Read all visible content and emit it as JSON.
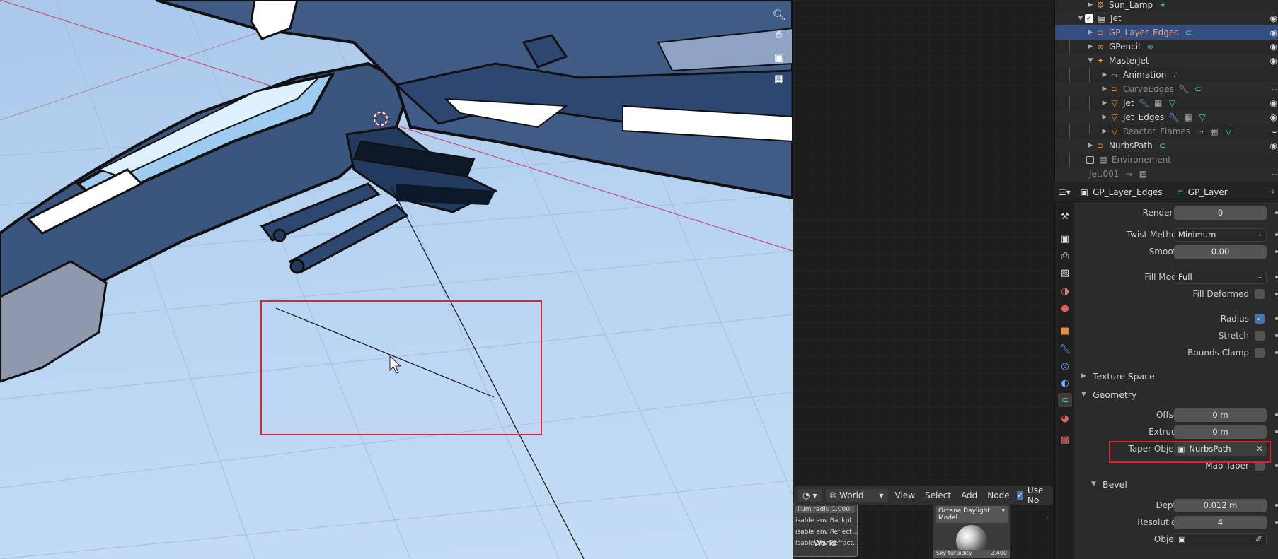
{
  "viewport": {
    "gizmo_icons": [
      "zoom-icon",
      "hand-icon",
      "camera-icon",
      "grid-icon"
    ]
  },
  "node_editor": {
    "header": {
      "world_label": "World",
      "menus": [
        "View",
        "Select",
        "Add",
        "Node"
      ],
      "use_nodes_label": "Use No"
    },
    "left_node": {
      "rows": [
        "lium radiu  1.000",
        "isable env Backpl...",
        "isable env Reflect...",
        "isable env Refract..."
      ],
      "title": "World"
    },
    "world_node": {
      "select_label": "Octane Daylight Model",
      "turbidity_label": "Sky turbidity",
      "turbidity_value": "2.400"
    }
  },
  "outliner": {
    "rows": [
      {
        "label": "Sun_Lamp",
        "icon": "lamp-icon",
        "style": "normal",
        "mods": [
          "sun-data-icon"
        ]
      },
      {
        "label": "Jet",
        "icon": "collection-icon",
        "style": "normal",
        "mods": []
      },
      {
        "label": "GP_Layer_Edges",
        "icon": "curve-object-icon",
        "style": "selected",
        "mods": [
          "curve-data-icon"
        ]
      },
      {
        "label": "GPencil",
        "icon": "grease-pencil-icon",
        "style": "normal",
        "mods": [
          "gpencil-data-icon"
        ]
      },
      {
        "label": "MasterJet",
        "icon": "armature-icon",
        "style": "normal",
        "mods": []
      },
      {
        "label": "Animation",
        "icon": "action-icon",
        "style": "normal",
        "mods": [
          "constraint-icon"
        ]
      },
      {
        "label": "CurveEdges",
        "icon": "curve-object-icon",
        "style": "dim",
        "mods": [
          "wrench-icon",
          "curve-data-icon"
        ]
      },
      {
        "label": "Jet",
        "icon": "mesh-icon",
        "style": "normal",
        "mods": [
          "wrench-icon",
          "modifier-icon",
          "mesh-data-icon"
        ]
      },
      {
        "label": "Jet_Edges",
        "icon": "mesh-icon",
        "style": "normal",
        "mods": [
          "wrench-icon",
          "modifier-icon",
          "mesh-data-icon"
        ]
      },
      {
        "label": "Reactor_Flames",
        "icon": "mesh-icon",
        "style": "dim",
        "mods": [
          "constraint-icon",
          "modifier-icon",
          "mesh-data-icon"
        ]
      },
      {
        "label": "NurbsPath",
        "icon": "curve-object-icon",
        "style": "normal",
        "mods": [
          "curve-data-icon"
        ]
      },
      {
        "label": "Environement",
        "icon": "collection-icon",
        "style": "dim",
        "mods": []
      },
      {
        "label": "Jet.001",
        "icon": "collection-icon",
        "style": "dim",
        "mods": [
          "constraint-icon",
          "collection-icon"
        ]
      }
    ]
  },
  "properties": {
    "header": {
      "object_name": "GP_Layer_Edges",
      "data_name": "GP_Layer"
    },
    "render_u": {
      "label": "Render U",
      "value": "0"
    },
    "twist_method": {
      "label": "Twist Method",
      "value": "Minimum"
    },
    "smooth": {
      "label": "Smooth",
      "value": "0.00"
    },
    "fill_mode": {
      "label": "Fill Mode",
      "value": "Full"
    },
    "fill_deformed": {
      "label": "Fill Deformed",
      "checked": false
    },
    "radius": {
      "label": "Radius",
      "checked": true
    },
    "stretch": {
      "label": "Stretch",
      "checked": false
    },
    "bounds_clamp": {
      "label": "Bounds Clamp",
      "checked": false
    },
    "texture_space": {
      "label": "Texture Space"
    },
    "geometry": {
      "label": "Geometry"
    },
    "offset": {
      "label": "Offset",
      "value": "0 m"
    },
    "extrude": {
      "label": "Extrude",
      "value": "0 m"
    },
    "taper_object": {
      "label": "Taper Object",
      "value": "NurbsPath"
    },
    "map_taper": {
      "label": "Map Taper",
      "checked": false
    },
    "bevel": {
      "label": "Bevel"
    },
    "depth": {
      "label": "Depth",
      "value": "0.012 m"
    },
    "resolution": {
      "label": "Resolution",
      "value": "4"
    },
    "object": {
      "label": "Object"
    }
  },
  "colors": {
    "accent": "#4772b3",
    "selection": "#334d80",
    "highlight_red": "#e0232e",
    "viewport_sky": "#b8d4f2"
  }
}
